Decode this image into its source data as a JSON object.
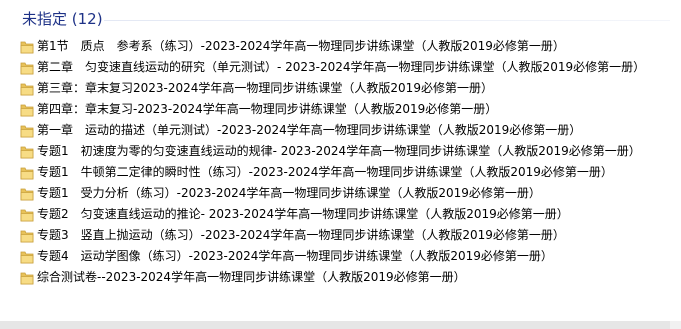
{
  "group": {
    "title": "未指定 (12)"
  },
  "files": [
    {
      "name": "第1节　质点　参考系（练习）-2023-2024学年高一物理同步讲练课堂（人教版2019必修第一册）",
      "icon": "folder-icon"
    },
    {
      "name": "第二章　匀变速直线运动的研究（单元测试）- 2023-2024学年高一物理同步讲练课堂（人教版2019必修第一册）",
      "icon": "folder-icon"
    },
    {
      "name": "第三章：章末复习2023-2024学年高一物理同步讲练课堂（人教版2019必修第一册）",
      "icon": "folder-icon"
    },
    {
      "name": "第四章：章末复习-2023-2024学年高一物理同步讲练课堂（人教版2019必修第一册）",
      "icon": "folder-icon"
    },
    {
      "name": "第一章　运动的描述（单元测试）-2023-2024学年高一物理同步讲练课堂（人教版2019必修第一册）",
      "icon": "folder-icon"
    },
    {
      "name": "专题1　初速度为零的匀变速直线运动的规律- 2023-2024学年高一物理同步讲练课堂（人教版2019必修第一册）",
      "icon": "folder-icon"
    },
    {
      "name": "专题1　牛顿第二定律的瞬时性（练习）-2023-2024学年高一物理同步讲练课堂（人教版2019必修第一册）",
      "icon": "folder-icon"
    },
    {
      "name": "专题1　受力分析（练习）-2023-2024学年高一物理同步讲练课堂（人教版2019必修第一册）",
      "icon": "folder-icon"
    },
    {
      "name": "专题2　匀变速直线运动的推论- 2023-2024学年高一物理同步讲练课堂（人教版2019必修第一册）",
      "icon": "folder-icon"
    },
    {
      "name": "专题3　竖直上抛运动（练习）-2023-2024学年高一物理同步讲练课堂（人教版2019必修第一册）",
      "icon": "folder-icon"
    },
    {
      "name": "专题4　运动学图像（练习）-2023-2024学年高一物理同步讲练课堂（人教版2019必修第一册）",
      "icon": "folder-icon"
    },
    {
      "name": "综合测试卷--2023-2024学年高一物理同步讲练课堂（人教版2019必修第一册）",
      "icon": "folder-icon"
    }
  ],
  "colors": {
    "group_title": "#1e3287",
    "folder_body": "#e8c25a",
    "folder_front": "#f7dc85",
    "folder_edge": "#c9a03c"
  }
}
